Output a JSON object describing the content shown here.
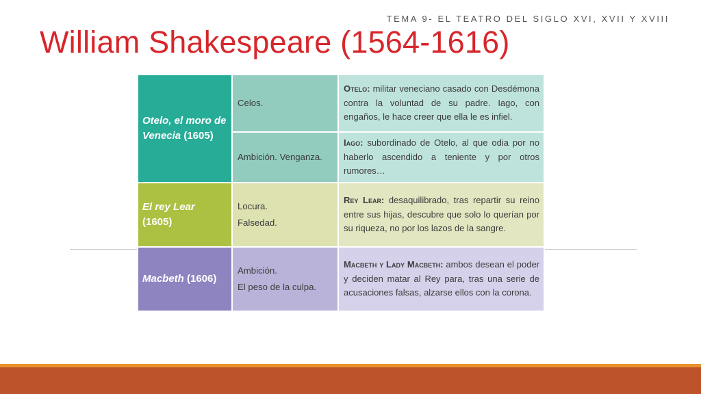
{
  "slide": {
    "subtitle": "TEMA 9- EL TEATRO DEL SIGLO XVI, XVII Y XVIII",
    "title": "William Shakespeare (1564-1616)"
  },
  "table": {
    "otelo": {
      "work": "Otelo, el moro de Venecia",
      "year": "(1605)",
      "rows": [
        {
          "theme": "Celos.",
          "name": "Otelo:",
          "text": " militar veneciano casado con Desdémona contra la voluntad de su padre. Iago, con engaños, le hace creer que ella le es infiel."
        },
        {
          "theme": "Ambición. Venganza.",
          "name": "Iago:",
          "text": " subordinado de Otelo, al que odia por no haberlo ascendido a teniente y por otros rumores…"
        }
      ]
    },
    "lear": {
      "work": "El rey Lear",
      "year": "(1605)",
      "theme_lines": [
        "Locura.",
        "Falsedad."
      ],
      "name": "Rey Lear:",
      "text": " desaquilibrado, tras repartir su reino entre sus hijas, descubre que solo lo querían por su riqueza, no por los lazos de la sangre."
    },
    "macbeth": {
      "work": "Macbeth",
      "year": "(1606)",
      "theme_lines": [
        "Ambición.",
        "El peso de la culpa."
      ],
      "name": "Macbeth y Lady Macbeth:",
      "text": " ambos desean el poder y deciden matar al Rey para, tras una serie de acusaciones falsas, alzarse ellos con la corona."
    }
  },
  "colors": {
    "title": "#d7262b",
    "otelo": "#27ac98",
    "lear": "#acc142",
    "macbeth": "#8d84c0",
    "footer_bar": "#bc532b",
    "footer_stripe": "#e8922c"
  }
}
